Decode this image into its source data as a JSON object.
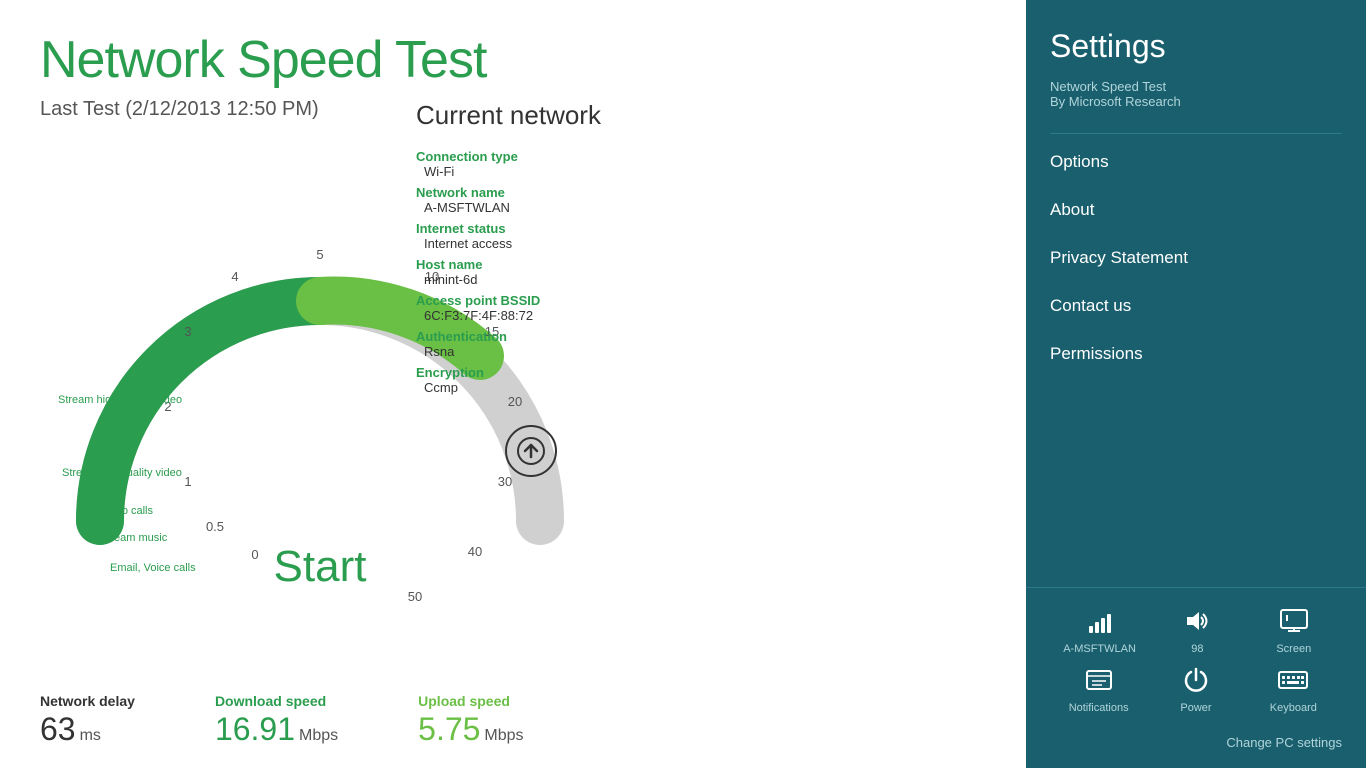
{
  "app": {
    "title": "Network Speed Test",
    "last_test": "Last Test (2/12/2013 12:50 PM)"
  },
  "gauge": {
    "numbers": [
      "0",
      "0.5",
      "1",
      "2",
      "3",
      "4",
      "5",
      "10",
      "15",
      "20",
      "30",
      "40",
      "50"
    ],
    "start_label": "Start",
    "speed_labels": [
      {
        "value": "0.5",
        "text": "Email, Voice calls",
        "angle": -10
      },
      {
        "value": "1",
        "text": "Stream music",
        "angle": 20
      },
      {
        "value": "1.5",
        "text": "Video calls",
        "angle": 40
      },
      {
        "value": "2",
        "text": "Stream low-quality video",
        "angle": 55
      },
      {
        "value": "3",
        "text": "Stream high-quality video",
        "angle": 70
      }
    ]
  },
  "stats": {
    "network_delay_label": "Network delay",
    "network_delay_value": "63",
    "network_delay_unit": "ms",
    "download_label": "Download speed",
    "download_value": "16.91",
    "download_unit": "Mbps",
    "upload_label": "Upload speed",
    "upload_value": "5.75",
    "upload_unit": "Mbps"
  },
  "network": {
    "title": "Current network",
    "connection_type_label": "Connection type",
    "connection_type_value": "Wi-Fi",
    "network_name_label": "Network name",
    "network_name_value": "A-MSFTWLAN",
    "internet_status_label": "Internet status",
    "internet_status_value": "Internet access",
    "host_name_label": "Host name",
    "host_name_value": "minint-6d",
    "access_point_label": "Access point BSSID",
    "access_point_value": "6C:F3:7F:4F:88:72",
    "authentication_label": "Authentication",
    "authentication_value": "Rsna",
    "encryption_label": "Encryption",
    "encryption_value": "Ccmp"
  },
  "settings": {
    "title": "Settings",
    "app_name": "Network Speed Test",
    "app_by": "By Microsoft Research",
    "menu": [
      {
        "id": "options",
        "label": "Options"
      },
      {
        "id": "about",
        "label": "About"
      },
      {
        "id": "privacy",
        "label": "Privacy Statement"
      },
      {
        "id": "contact",
        "label": "Contact us"
      },
      {
        "id": "permissions",
        "label": "Permissions"
      }
    ]
  },
  "system_bar": {
    "wifi_label": "A-MSFTWLAN",
    "volume_label": "98",
    "screen_label": "Screen",
    "notifications_label": "Notifications",
    "power_label": "Power",
    "keyboard_label": "Keyboard",
    "change_pc_label": "Change PC settings"
  }
}
